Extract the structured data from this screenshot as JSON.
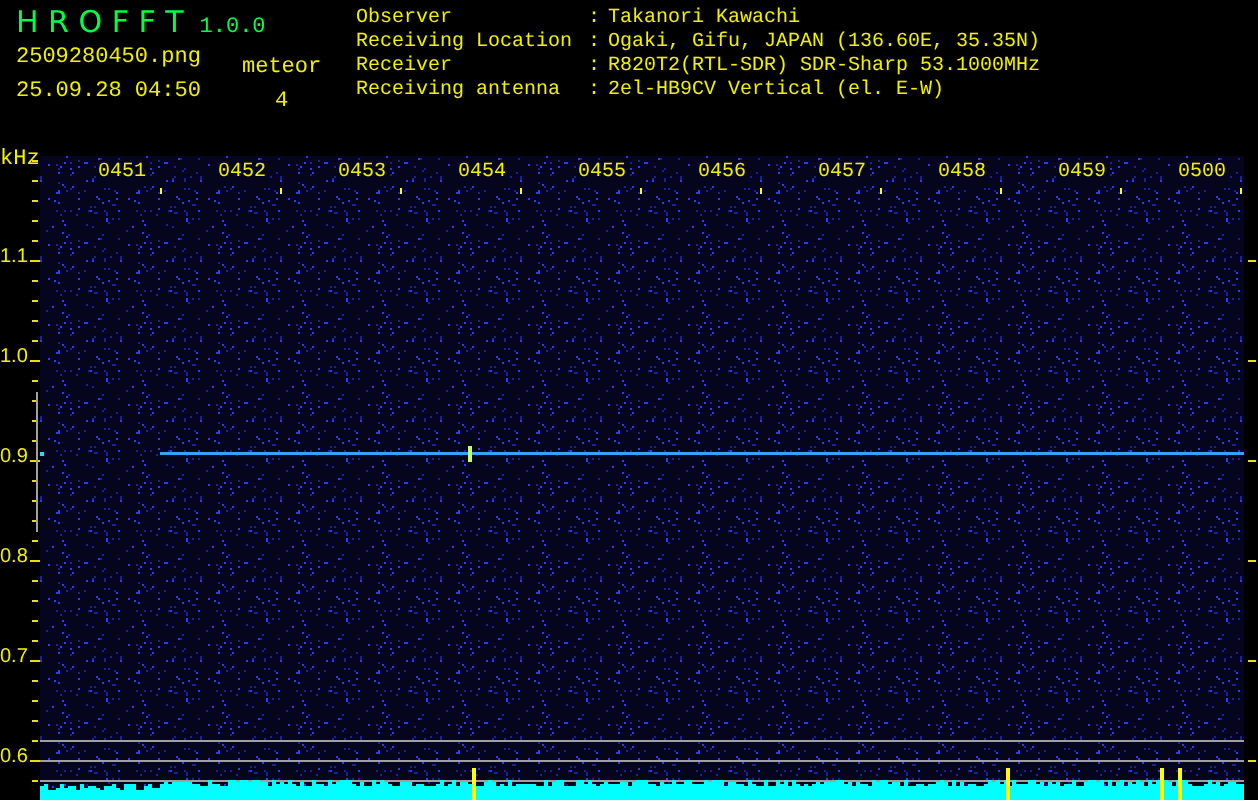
{
  "app": {
    "name": "H R O F F T",
    "version": "1.0.0"
  },
  "file": {
    "name": "2509280450.png",
    "datetime": "25.09.28 04:50"
  },
  "meteor": {
    "label": "meteor",
    "count": "4"
  },
  "info": [
    {
      "label": "Observer",
      "separator": ":",
      "value": "Takanori Kawachi"
    },
    {
      "label": "Receiving Location",
      "separator": ":",
      "value": "Ogaki, Gifu, JAPAN (136.60E, 35.35N)"
    },
    {
      "label": "Receiver",
      "separator": ":",
      "value": "R820T2(RTL-SDR) SDR-Sharp 53.1000MHz"
    },
    {
      "label": "Receiving antenna",
      "separator": ":",
      "value": "2el-HB9CV Vertical (el. E-W)"
    }
  ],
  "spectrogram": {
    "unit": "kHz",
    "time_labels": [
      "0451",
      "0452",
      "0453",
      "0454",
      "0455",
      "0456",
      "0457",
      "0458",
      "0459",
      "0500"
    ],
    "freq_labels": [
      "1.1",
      "1.0",
      "0.9",
      "0.8",
      "0.7",
      "0.6"
    ]
  }
}
